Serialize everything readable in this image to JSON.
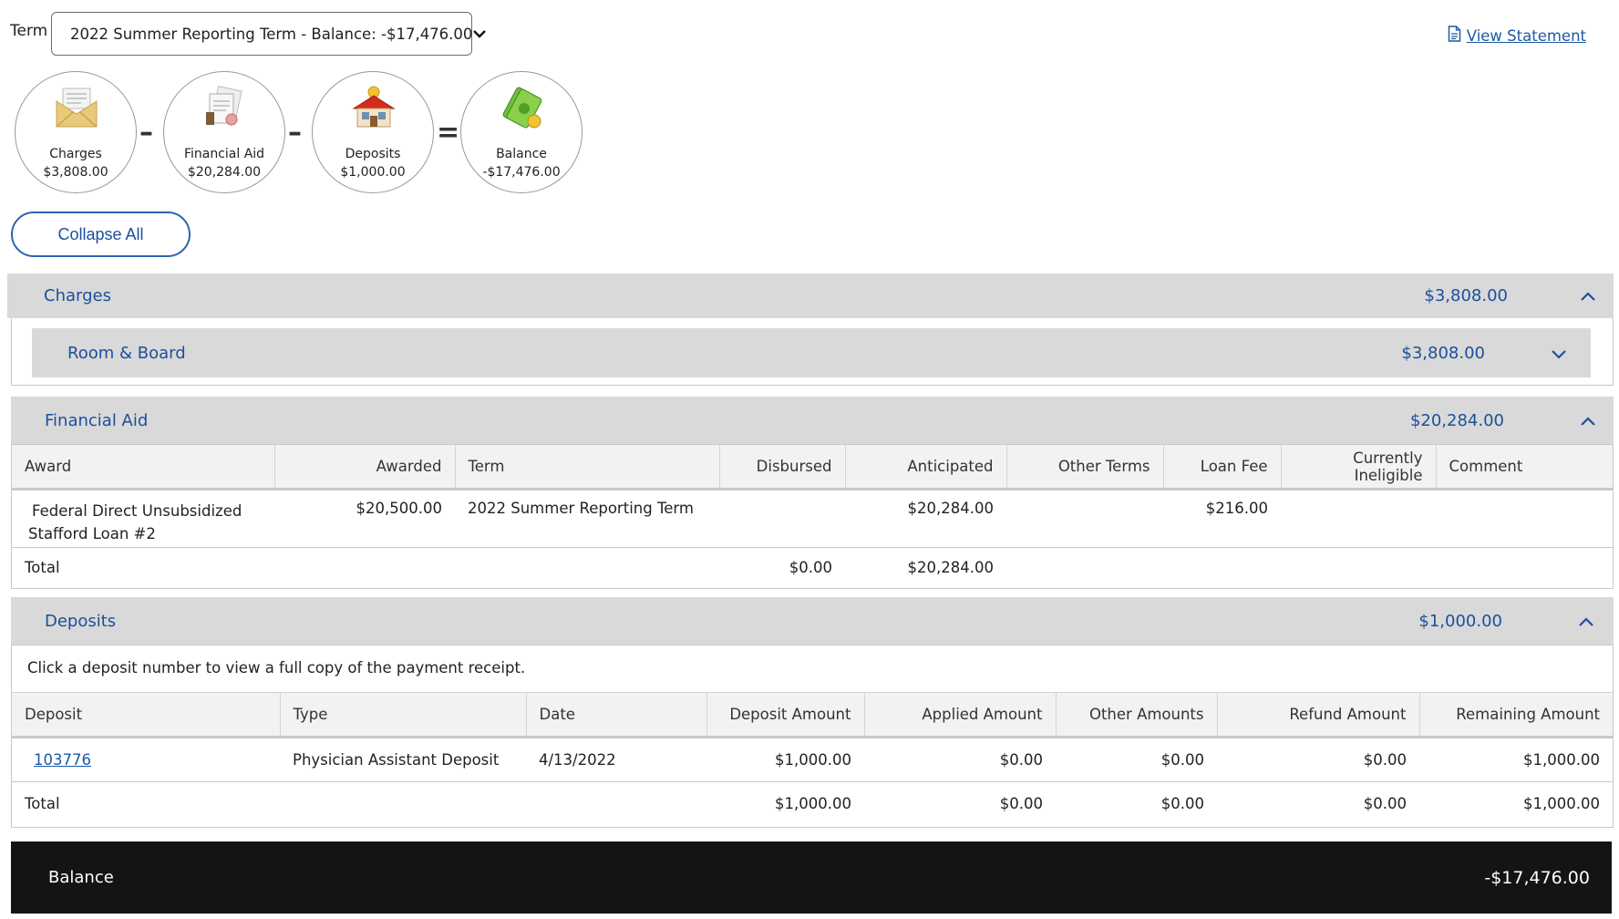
{
  "term": {
    "label": "Term",
    "selected": "2022 Summer Reporting Term - Balance: -$17,476.00"
  },
  "view_statement": "View Statement",
  "summary": {
    "charges": {
      "label": "Charges",
      "amount": "$3,808.00"
    },
    "financial_aid": {
      "label": "Financial Aid",
      "amount": "$20,284.00"
    },
    "deposits": {
      "label": "Deposits",
      "amount": "$1,000.00"
    },
    "balance": {
      "label": "Balance",
      "amount": "-$17,476.00"
    },
    "op_minus": "–",
    "op_equals": "="
  },
  "collapse_all": "Collapse All",
  "charges_section": {
    "title": "Charges",
    "amount": "$3,808.00",
    "sub": {
      "title": "Room & Board",
      "amount": "$3,808.00"
    }
  },
  "financial_aid_section": {
    "title": "Financial Aid",
    "amount": "$20,284.00",
    "columns": [
      "Award",
      "Awarded",
      "Term",
      "Disbursed",
      "Anticipated",
      "Other Terms",
      "Loan Fee",
      "Currently Ineligible",
      "Comment"
    ],
    "row": {
      "award_line1": "Federal Direct Unsubsidized",
      "award_line2": "Stafford Loan #2",
      "awarded": "$20,500.00",
      "term": "2022 Summer Reporting Term",
      "disbursed": "",
      "anticipated": "$20,284.00",
      "other_terms": "",
      "loan_fee": "$216.00",
      "ineligible": "",
      "comment": ""
    },
    "total": {
      "label": "Total",
      "disbursed": "$0.00",
      "anticipated": "$20,284.00"
    }
  },
  "deposits_section": {
    "title": "Deposits",
    "amount": "$1,000.00",
    "note": "Click a deposit number to view a full copy of the payment receipt.",
    "columns": [
      "Deposit",
      "Type",
      "Date",
      "Deposit Amount",
      "Applied Amount",
      "Other Amounts",
      "Refund Amount",
      "Remaining Amount"
    ],
    "row": {
      "deposit": "103776",
      "type": "Physician Assistant Deposit",
      "date": "4/13/2022",
      "deposit_amount": "$1,000.00",
      "applied": "$0.00",
      "other": "$0.00",
      "refund": "$0.00",
      "remaining": "$1,000.00"
    },
    "total": {
      "label": "Total",
      "deposit_amount": "$1,000.00",
      "applied": "$0.00",
      "other": "$0.00",
      "refund": "$0.00",
      "remaining": "$1,000.00"
    }
  },
  "balance_bar": {
    "label": "Balance",
    "amount": "-$17,476.00"
  }
}
